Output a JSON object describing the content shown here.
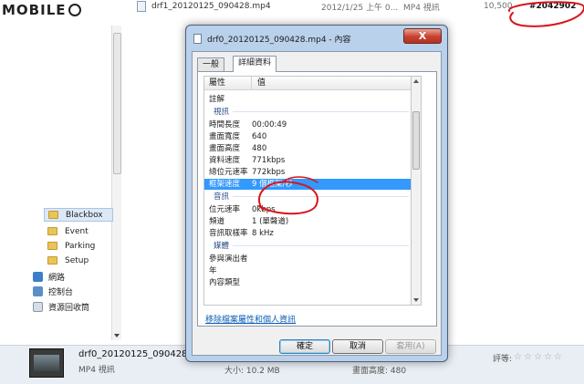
{
  "watermark": {
    "text": "MOBILE"
  },
  "explorer": {
    "file_row": {
      "name": "drf1_20120125_090428.mp4",
      "date": "2012/1/25 上午 0...",
      "type": "MP4 視訊",
      "size": "10,500",
      "tag": "#2042902"
    },
    "nav": {
      "folders": [
        "Blackbox",
        "Event",
        "Parking",
        "Setup"
      ],
      "system": [
        "網路",
        "控制台",
        "資源回收筒"
      ]
    },
    "details_bar": {
      "name": "drf0_20120125_090428...",
      "type": "MP4 視訊",
      "size": "大小: 10.2 MB",
      "frame_height": "畫面高度: 480",
      "rating_label": "評等:"
    }
  },
  "dialog": {
    "title": "drf0_20120125_090428.mp4 - 內容",
    "close": "X",
    "tabs": [
      "一般",
      "詳細資料"
    ],
    "columns": {
      "property": "屬性",
      "value": "值"
    },
    "rows": [
      {
        "kind": "row",
        "k": "註解",
        "v": ""
      },
      {
        "kind": "group",
        "k": "視訊"
      },
      {
        "kind": "row",
        "k": "時間長度",
        "v": "00:00:49"
      },
      {
        "kind": "row",
        "k": "畫面寬度",
        "v": "640"
      },
      {
        "kind": "row",
        "k": "畫面高度",
        "v": "480"
      },
      {
        "kind": "row",
        "k": "資料速度",
        "v": "771kbps"
      },
      {
        "kind": "row",
        "k": "總位元速率",
        "v": "772kbps"
      },
      {
        "kind": "row",
        "k": "框架速度",
        "v": "9 個框架/秒",
        "selected": true
      },
      {
        "kind": "group",
        "k": "音訊"
      },
      {
        "kind": "row",
        "k": "位元速率",
        "v": "0kbps"
      },
      {
        "kind": "row",
        "k": "頻道",
        "v": "1 (單聲道)"
      },
      {
        "kind": "row",
        "k": "音訊取樣率",
        "v": "8 kHz"
      },
      {
        "kind": "group",
        "k": "媒體"
      },
      {
        "kind": "row",
        "k": "參與演出者",
        "v": ""
      },
      {
        "kind": "row",
        "k": "年",
        "v": ""
      },
      {
        "kind": "row",
        "k": "內容類型",
        "v": ""
      }
    ],
    "remove_link": "移除檔案屬性和個人資訊",
    "buttons": {
      "ok": "確定",
      "cancel": "取消",
      "apply": "套用(A)"
    }
  },
  "colors": {
    "selection": "#3399ff",
    "annotation": "#d9141c",
    "link": "#0b5cb5"
  }
}
